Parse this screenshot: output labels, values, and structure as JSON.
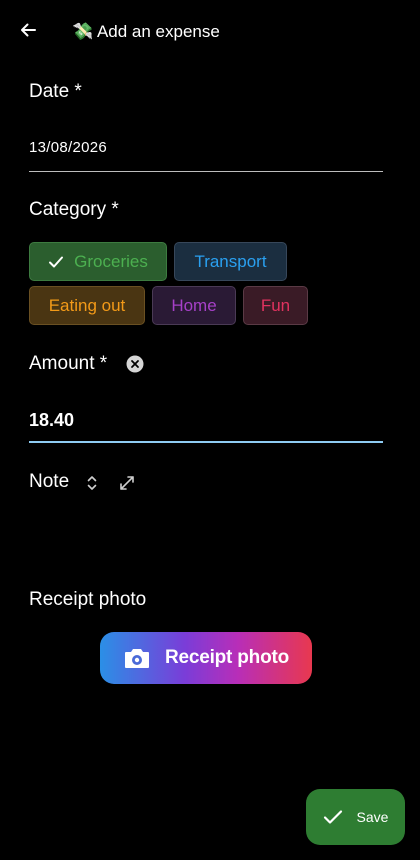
{
  "header": {
    "back_icon": "arrow-left-icon",
    "title": "💸 Add an expense"
  },
  "date": {
    "label": "Date *",
    "value": "13/08/2026"
  },
  "category": {
    "label": "Category *",
    "options": [
      {
        "label": "Groceries",
        "selected": true,
        "color": "#4cb050"
      },
      {
        "label": "Transport",
        "selected": false,
        "color": "#2aa0f0"
      },
      {
        "label": "Eating out",
        "selected": false,
        "color": "#f39a18"
      },
      {
        "label": "Home",
        "selected": false,
        "color": "#a640c8"
      },
      {
        "label": "Fun",
        "selected": false,
        "color": "#e0325f"
      }
    ]
  },
  "amount": {
    "label": "Amount *",
    "value": "18.40",
    "clear_icon": "clear-circle-icon"
  },
  "note": {
    "label": "Note",
    "sort_icon": "unfold-icon",
    "expand_icon": "expand-icon"
  },
  "receipt": {
    "label": "Receipt photo",
    "button_label": "Receipt photo",
    "button_icon": "camera-icon"
  },
  "save": {
    "label": "Save",
    "icon": "check-icon",
    "color": "#2e7d32"
  }
}
